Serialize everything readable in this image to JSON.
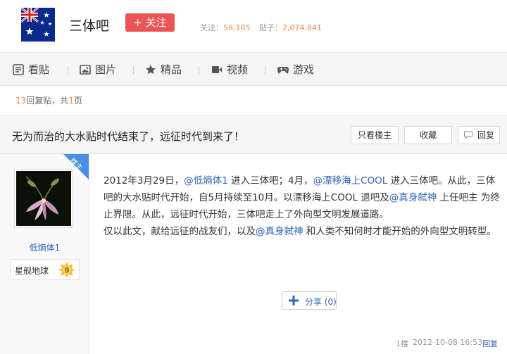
{
  "header": {
    "forum_name": "三体吧",
    "follow_label": "+ 关注",
    "followers_label": "关注：",
    "followers_count": "58,105",
    "posts_label": "贴子：",
    "posts_count": "2,074,841",
    "logo_icon": "australian-flag-logo"
  },
  "nav": {
    "items": [
      {
        "label": "看贴",
        "icon": "posts-list-icon"
      },
      {
        "label": "图片",
        "icon": "picture-icon"
      },
      {
        "label": "精品",
        "icon": "star-icon"
      },
      {
        "label": "视频",
        "icon": "video-camera-icon"
      },
      {
        "label": "游戏",
        "icon": "gamepad-icon"
      }
    ]
  },
  "reply_info": {
    "count": "13",
    "reply_label": "回复贴，共",
    "pages": "1",
    "page_label": "页"
  },
  "thread": {
    "title": "无为而治的大水贴时代结束了，远征时代到来了！",
    "only_op_label": "只看楼主",
    "collect_label": "收藏",
    "reply_label": "回复"
  },
  "author": {
    "op_badge": "楼主",
    "username": "低熵体1",
    "level_name": "星舰地球",
    "level_num": "9"
  },
  "post": {
    "seg1": "2012年3月29日，",
    "link1": "@低熵体1",
    "seg2": " 进入三体吧；4月，",
    "link2": "@漂移海上COOL",
    "seg3": " 进入三体吧。从此，三体吧的大水贴时代开始，自5月持续至10月。以漂移海上COOL 退吧及",
    "link3": "@真身弑神",
    "seg4": " 上任吧主 为终止界限。从此，远征时代开始，三体吧走上了外向型文明发展道路。",
    "seg5": "仅以此文，献给远征的战友们，以及",
    "link4": "@真身弑神",
    "seg6": " 和人类不知何时才能开始的外向型文明转型。",
    "share_label": "分享",
    "share_count": "(0)",
    "floor": "1楼",
    "timestamp": "2012-10-08 16:53",
    "reply_link": "回复"
  },
  "colors": {
    "follow_button": "#ea5455",
    "link": "#2d64b3",
    "accent_number": "#f08b4b",
    "op_badge": "#4a90e2"
  }
}
